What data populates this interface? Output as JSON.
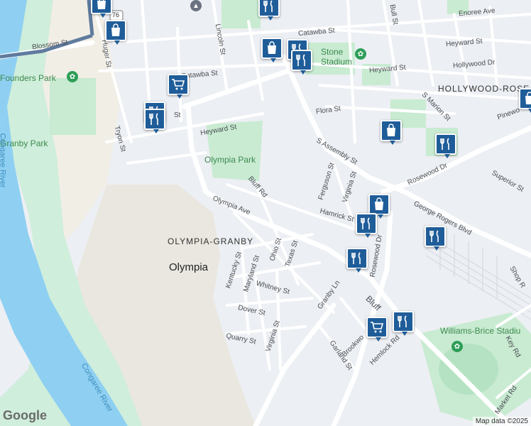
{
  "labels": {
    "blossom_st": "Blossom St",
    "huger_st": "Huger St",
    "lincoln_st": "Lincoln St",
    "catawba_st_top": "Catawba St",
    "catawba_st": "Catawba St",
    "heyward_st_left": "Heyward St",
    "heyward_st_right": "Heyward St",
    "heyward_st_far": "Heyward St",
    "hollywood_dr": "Hollywood Dr",
    "enoree_ave": "Enoree Ave",
    "bull_st": "Bull St",
    "s_marion_st": "S Marion St",
    "pinewood": "Pinewo",
    "flora_st": "Flora St",
    "s_assembly_st": "S Assembly St",
    "tryon_st": "Tryon St",
    "st_stub": "St",
    "bluff_rd": "Bluff Rd",
    "olympia_ave": "Olympia Ave",
    "ferguson_st": "Ferguson St",
    "virginia_st_top": "Virginia St",
    "hamrick_st": "Hamrick St",
    "rosewood_dr": "Rosewood Dr",
    "rosewood_dr_diag": "Rosewood Dr",
    "superior_st": "Superior St",
    "george_rogers_blvd": "George Rogers Blvd",
    "shop_rd": "Shop R",
    "kentucky_st": "Kentucky St",
    "maryland_st": "Maryland St",
    "ohio_st": "Ohio St",
    "texas_st": "Texas St",
    "whitney_st": "Whitney St",
    "granby_ln": "Granby Ln",
    "dover_st": "Dover St",
    "quarry_st": "Quarry St",
    "virginia_st": "Virginia St",
    "garland_st": "Garland St",
    "brookwood": "Brookwo",
    "hemlock_rd": "Hemlock Rd",
    "key_rd": "Key Rd",
    "market_rd": "Market Rd",
    "bluff": "Bluff",
    "stadium_partial": "Stone\nStadium",
    "williams_brice": "Williams-Brice Stadiu",
    "founders_park": "Founders Park",
    "granby_park": "Granby Park",
    "olympia_park": "Olympia Park",
    "olympia_granby": "OLYMPIA-GRANBY",
    "olympia": "Olympia",
    "hollywood_rose": "HOLLYWOOD-ROSE",
    "congaree_river_left": "Congaree River",
    "congaree_river_bottom": "Congaree River",
    "shield_76": "76"
  },
  "pois": [
    {
      "name": "shopping-bag-icon",
      "kind": "shopping"
    },
    {
      "name": "restaurant-icon",
      "kind": "restaurant"
    },
    {
      "name": "grocery-cart-icon",
      "kind": "grocery"
    }
  ],
  "attribution": {
    "google": "Google",
    "map_data": "Map data ©2025"
  },
  "colors": {
    "land": "#eceff3",
    "water": "#8fd0f2",
    "park": "#c8ebd1",
    "road": "#ffffff",
    "poi_blue": "#1f5d99",
    "industrial": "#e6e2d8"
  }
}
